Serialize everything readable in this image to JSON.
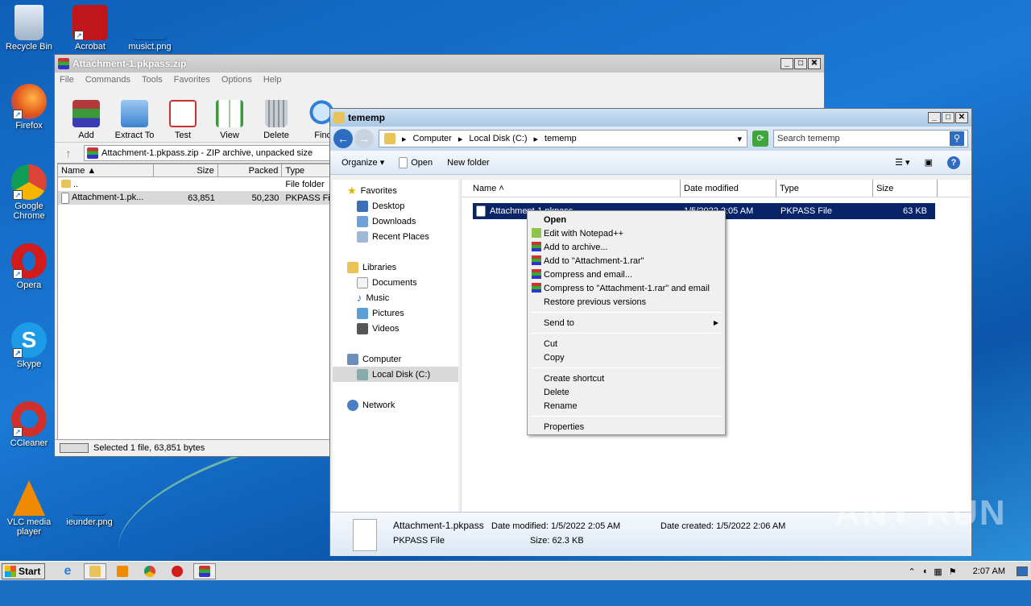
{
  "desktop": {
    "icons": [
      {
        "label": "Recycle Bin",
        "icon": "recycle-bin-icon",
        "color": "#c9d6e6"
      },
      {
        "label": "Acrobat",
        "icon": "acrobat-icon",
        "color": "#c0161b"
      },
      {
        "label": "musict.png",
        "icon": "image-file-icon",
        "color": "#1a6fc4"
      },
      {
        "label": "Firefox",
        "icon": "firefox-icon",
        "color": "#f57c1f"
      },
      {
        "label": "Google Chrome",
        "icon": "chrome-icon",
        "color": "#3aa757"
      },
      {
        "label": "Opera",
        "icon": "opera-icon",
        "color": "#d21b1b"
      },
      {
        "label": "Skype",
        "icon": "skype-icon",
        "color": "#1e9be6"
      },
      {
        "label": "CCleaner",
        "icon": "ccleaner-icon",
        "color": "#d0302a"
      },
      {
        "label": "VLC media player",
        "icon": "vlc-icon",
        "color": "#f08a00"
      },
      {
        "label": "ieunder.png",
        "icon": "image-file-icon",
        "color": "#1a6fc4"
      }
    ]
  },
  "winrar": {
    "title": "Attachment-1.pkpass.zip",
    "menu": [
      "File",
      "Commands",
      "Tools",
      "Favorites",
      "Options",
      "Help"
    ],
    "toolbar": [
      {
        "label": "Add",
        "icon": "add-archive-icon",
        "color": "#b33a3a"
      },
      {
        "label": "Extract To",
        "icon": "extract-folder-icon",
        "color": "#3c82d0"
      },
      {
        "label": "Test",
        "icon": "test-icon",
        "color": "#c8322f"
      },
      {
        "label": "View",
        "icon": "view-book-icon",
        "color": "#3a9a3a"
      },
      {
        "label": "Delete",
        "icon": "delete-bin-icon",
        "color": "#9aa4ae"
      },
      {
        "label": "Find",
        "icon": "find-magnifier-icon",
        "color": "#2f7fd6"
      }
    ],
    "path": "Attachment-1.pkpass.zip - ZIP archive, unpacked size",
    "columns": [
      "Name",
      "Size",
      "Packed",
      "Type"
    ],
    "rows": [
      {
        "name": "..",
        "size": "",
        "packed": "",
        "type": "File folder"
      },
      {
        "name": "Attachment-1.pk...",
        "size": "63,851",
        "packed": "50,230",
        "type": "PKPASS Fil"
      }
    ],
    "status": "Selected 1 file, 63,851 bytes"
  },
  "explorer": {
    "title": "tememp",
    "breadcrumb": [
      "Computer",
      "Local Disk (C:)",
      "tememp"
    ],
    "search_placeholder": "Search tememp",
    "commands": {
      "organize": "Organize",
      "open": "Open",
      "new_folder": "New folder"
    },
    "nav": {
      "favorites": "Favorites",
      "desktop": "Desktop",
      "downloads": "Downloads",
      "recent": "Recent Places",
      "libraries": "Libraries",
      "documents": "Documents",
      "music": "Music",
      "pictures": "Pictures",
      "videos": "Videos",
      "computer": "Computer",
      "local_disk": "Local Disk (C:)",
      "network": "Network"
    },
    "columns": [
      "Name",
      "Date modified",
      "Type",
      "Size"
    ],
    "file": {
      "name": "Attachment-1.pkpass",
      "date": "1/5/2022 2:05 AM",
      "type": "PKPASS File",
      "size": "63 KB",
      "date_visible": "1/5/2022 2:05 AM"
    },
    "details": {
      "name": "Attachment-1.pkpass",
      "type": "PKPASS File",
      "modified": "Date modified: 1/5/2022 2:05 AM",
      "size": "Size: 62.3 KB",
      "created": "Date created: 1/5/2022 2:06 AM"
    }
  },
  "context_menu": {
    "open": "Open",
    "notepad": "Edit with Notepad++",
    "add_archive": "Add to archive...",
    "add_rar": "Add to \"Attachment-1.rar\"",
    "compress_email": "Compress and email...",
    "compress_rar_email": "Compress to \"Attachment-1.rar\" and email",
    "restore": "Restore previous versions",
    "send_to": "Send to",
    "cut": "Cut",
    "copy": "Copy",
    "create_shortcut": "Create shortcut",
    "delete": "Delete",
    "rename": "Rename",
    "properties": "Properties"
  },
  "taskbar": {
    "start": "Start",
    "clock": "2:07 AM"
  },
  "watermark": "ANY RUN"
}
